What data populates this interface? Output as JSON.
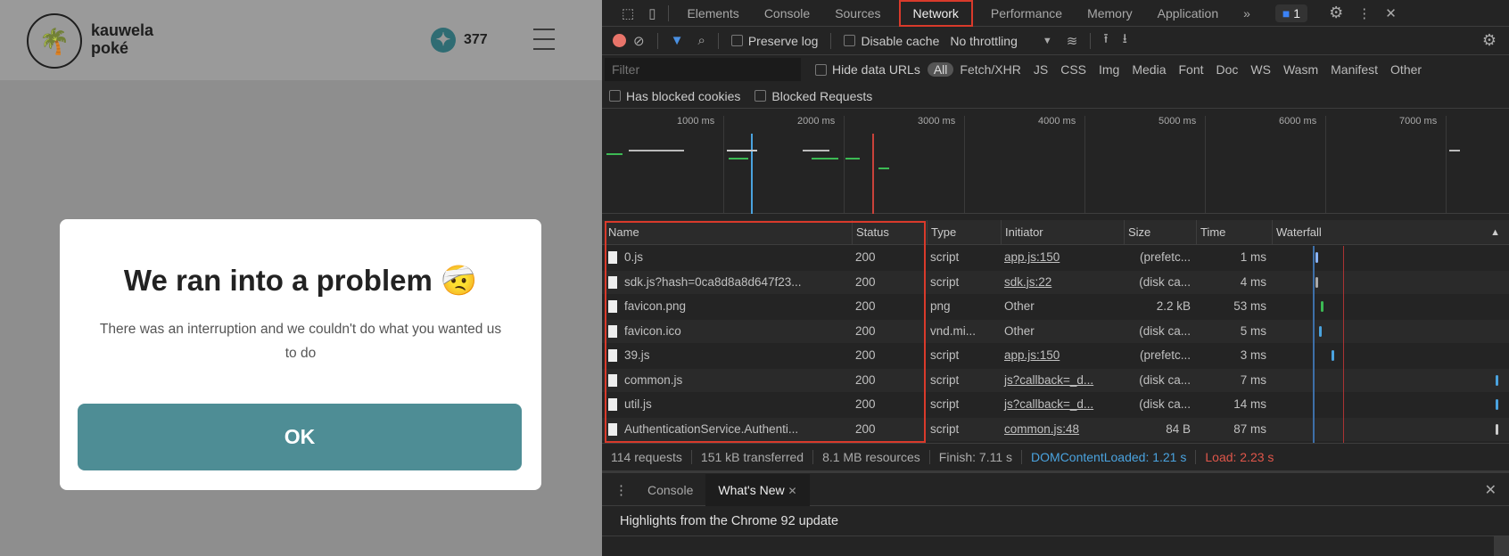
{
  "page": {
    "logo": {
      "line1": "kauwela",
      "line2": "poké"
    },
    "points": "377",
    "dialog": {
      "title": "We ran into a problem 🤕",
      "body": "There was an interruption and we couldn't do what you wanted us to do",
      "ok_label": "OK"
    }
  },
  "devtools": {
    "tabs": [
      "Elements",
      "Console",
      "Sources",
      "Network",
      "Performance",
      "Memory",
      "Application"
    ],
    "more": "»",
    "messages_count": "1",
    "toolbar": {
      "preserve_log": "Preserve log",
      "disable_cache": "Disable cache",
      "throttling": "No throttling"
    },
    "filter": {
      "placeholder": "Filter",
      "hide_data_urls": "Hide data URLs",
      "types": [
        "All",
        "Fetch/XHR",
        "JS",
        "CSS",
        "Img",
        "Media",
        "Font",
        "Doc",
        "WS",
        "Wasm",
        "Manifest",
        "Other"
      ]
    },
    "blocked": {
      "cookies": "Has blocked cookies",
      "requests": "Blocked Requests"
    },
    "timeline_ticks": [
      "1000 ms",
      "2000 ms",
      "3000 ms",
      "4000 ms",
      "5000 ms",
      "6000 ms",
      "7000 ms"
    ],
    "columns": [
      "Name",
      "Status",
      "Type",
      "Initiator",
      "Size",
      "Time",
      "Waterfall"
    ],
    "rows": [
      {
        "name": "0.js",
        "status": "200",
        "type": "script",
        "initiator": "app.js:150",
        "link": true,
        "size": "(prefetc...",
        "time": "1 ms"
      },
      {
        "name": "sdk.js?hash=0ca8d8a8d647f23...",
        "status": "200",
        "type": "script",
        "initiator": "sdk.js:22",
        "link": true,
        "size": "(disk ca...",
        "time": "4 ms"
      },
      {
        "name": "favicon.png",
        "status": "200",
        "type": "png",
        "initiator": "Other",
        "link": false,
        "size": "2.2 kB",
        "time": "53 ms"
      },
      {
        "name": "favicon.ico",
        "status": "200",
        "type": "vnd.mi...",
        "initiator": "Other",
        "link": false,
        "size": "(disk ca...",
        "time": "5 ms"
      },
      {
        "name": "39.js",
        "status": "200",
        "type": "script",
        "initiator": "app.js:150",
        "link": true,
        "size": "(prefetc...",
        "time": "3 ms"
      },
      {
        "name": "common.js",
        "status": "200",
        "type": "script",
        "initiator": "js?callback=_d...",
        "link": true,
        "size": "(disk ca...",
        "time": "7 ms"
      },
      {
        "name": "util.js",
        "status": "200",
        "type": "script",
        "initiator": "js?callback=_d...",
        "link": true,
        "size": "(disk ca...",
        "time": "14 ms"
      },
      {
        "name": "AuthenticationService.Authenti...",
        "status": "200",
        "type": "script",
        "initiator": "common.js:48",
        "link": true,
        "size": "84 B",
        "time": "87 ms"
      }
    ],
    "summary": {
      "requests": "114 requests",
      "transferred": "151 kB transferred",
      "resources": "8.1 MB resources",
      "finish": "Finish: 7.11 s",
      "dcl": "DOMContentLoaded: 1.21 s",
      "load": "Load: 2.23 s"
    },
    "drawer": {
      "tabs": [
        "Console",
        "What's New"
      ],
      "highlight": "Highlights from the Chrome 92 update"
    },
    "colors": {
      "dcl": "#4aa3df",
      "load": "#e0564a",
      "highlight_box": "#d93a2b"
    }
  }
}
